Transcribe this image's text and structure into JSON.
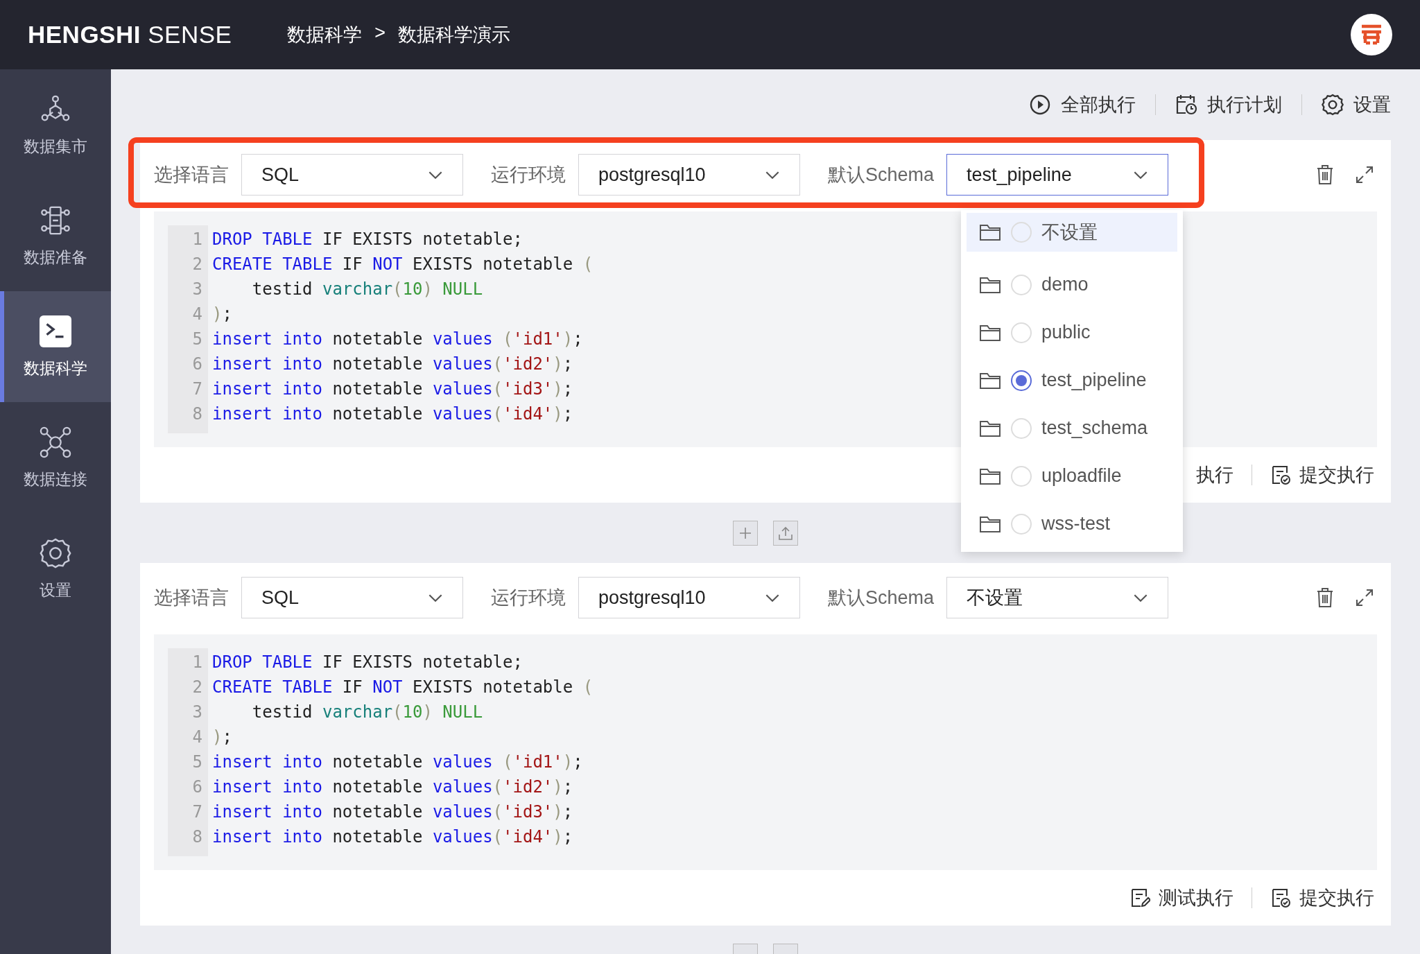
{
  "header": {
    "logo": "**HENGSHI** SENSE",
    "breadcrumb": [
      "数据科学",
      "数据科学演示"
    ],
    "separator": ">"
  },
  "sidebar": {
    "items": [
      {
        "label": "数据集市",
        "selected": false
      },
      {
        "label": "数据准备",
        "selected": false
      },
      {
        "label": "数据科学",
        "selected": true
      },
      {
        "label": "数据连接",
        "selected": false
      },
      {
        "label": "设置",
        "selected": false
      }
    ]
  },
  "toolbar": [
    "全部执行",
    "执行计划",
    "设置"
  ],
  "cells": [
    {
      "highlighted": true,
      "language_label": "选择语言",
      "language": "SQL",
      "env_label": "运行环境",
      "env": "postgresql10",
      "schema_label": "默认Schema",
      "schema": "test_pipeline",
      "schema_open": true,
      "code": [
        [
          {
            "kind": "keyword",
            "text": "DROP TABLE"
          },
          {
            "kind": "plain",
            "text": " IF EXISTS notetable;"
          }
        ],
        [
          {
            "kind": "keyword",
            "text": "CREATE TABLE"
          },
          {
            "kind": "plain",
            "text": " IF "
          },
          {
            "kind": "keyword",
            "text": "NOT"
          },
          {
            "kind": "plain",
            "text": " EXISTS notetable "
          },
          {
            "kind": "paren",
            "text": "("
          }
        ],
        [
          {
            "kind": "plain",
            "text": "    testid "
          },
          {
            "kind": "type",
            "text": "varchar"
          },
          {
            "kind": "paren",
            "text": "("
          },
          {
            "kind": "number",
            "text": "10"
          },
          {
            "kind": "paren",
            "text": ")"
          },
          {
            "kind": "null",
            "text": " NULL"
          }
        ],
        [
          {
            "kind": "paren",
            "text": ")"
          },
          {
            "kind": "plain",
            "text": ";"
          }
        ],
        [
          {
            "kind": "keyword",
            "text": "insert into"
          },
          {
            "kind": "plain",
            "text": " notetable "
          },
          {
            "kind": "keyword",
            "text": "values "
          },
          {
            "kind": "paren",
            "text": "("
          },
          {
            "kind": "string",
            "text": "'id1'"
          },
          {
            "kind": "paren",
            "text": ")"
          },
          {
            "kind": "plain",
            "text": ";"
          }
        ],
        [
          {
            "kind": "keyword",
            "text": "insert into"
          },
          {
            "kind": "plain",
            "text": " notetable "
          },
          {
            "kind": "keyword",
            "text": "values"
          },
          {
            "kind": "paren",
            "text": "("
          },
          {
            "kind": "string",
            "text": "'id2'"
          },
          {
            "kind": "paren",
            "text": ")"
          },
          {
            "kind": "plain",
            "text": ";"
          }
        ],
        [
          {
            "kind": "keyword",
            "text": "insert into"
          },
          {
            "kind": "plain",
            "text": " notetable "
          },
          {
            "kind": "keyword",
            "text": "values"
          },
          {
            "kind": "paren",
            "text": "("
          },
          {
            "kind": "string",
            "text": "'id3'"
          },
          {
            "kind": "paren",
            "text": ")"
          },
          {
            "kind": "plain",
            "text": ";"
          }
        ],
        [
          {
            "kind": "keyword",
            "text": "insert into"
          },
          {
            "kind": "plain",
            "text": " notetable "
          },
          {
            "kind": "keyword",
            "text": "values"
          },
          {
            "kind": "paren",
            "text": "("
          },
          {
            "kind": "string",
            "text": "'id4'"
          },
          {
            "kind": "paren",
            "text": ")"
          },
          {
            "kind": "plain",
            "text": ";"
          }
        ]
      ],
      "line_numbers": [
        "1",
        "2",
        "3",
        "4",
        "5",
        "6",
        "7",
        "8"
      ],
      "footer": [
        {
          "kind": "cut",
          "label": "执行"
        },
        {
          "kind": "submit",
          "label": "提交执行"
        }
      ]
    },
    {
      "highlighted": false,
      "language_label": "选择语言",
      "language": "SQL",
      "env_label": "运行环境",
      "env": "postgresql10",
      "schema_label": "默认Schema",
      "schema": "不设置",
      "schema_open": false,
      "code": [
        [
          {
            "kind": "keyword",
            "text": "DROP TABLE"
          },
          {
            "kind": "plain",
            "text": " IF EXISTS notetable;"
          }
        ],
        [
          {
            "kind": "keyword",
            "text": "CREATE TABLE"
          },
          {
            "kind": "plain",
            "text": " IF "
          },
          {
            "kind": "keyword",
            "text": "NOT"
          },
          {
            "kind": "plain",
            "text": " EXISTS notetable "
          },
          {
            "kind": "paren",
            "text": "("
          }
        ],
        [
          {
            "kind": "plain",
            "text": "    testid "
          },
          {
            "kind": "type",
            "text": "varchar"
          },
          {
            "kind": "paren",
            "text": "("
          },
          {
            "kind": "number",
            "text": "10"
          },
          {
            "kind": "paren",
            "text": ")"
          },
          {
            "kind": "null",
            "text": " NULL"
          }
        ],
        [
          {
            "kind": "paren",
            "text": ")"
          },
          {
            "kind": "plain",
            "text": ";"
          }
        ],
        [
          {
            "kind": "keyword",
            "text": "insert into"
          },
          {
            "kind": "plain",
            "text": " notetable "
          },
          {
            "kind": "keyword",
            "text": "values "
          },
          {
            "kind": "paren",
            "text": "("
          },
          {
            "kind": "string",
            "text": "'id1'"
          },
          {
            "kind": "paren",
            "text": ")"
          },
          {
            "kind": "plain",
            "text": ";"
          }
        ],
        [
          {
            "kind": "keyword",
            "text": "insert into"
          },
          {
            "kind": "plain",
            "text": " notetable "
          },
          {
            "kind": "keyword",
            "text": "values"
          },
          {
            "kind": "paren",
            "text": "("
          },
          {
            "kind": "string",
            "text": "'id2'"
          },
          {
            "kind": "paren",
            "text": ")"
          },
          {
            "kind": "plain",
            "text": ";"
          }
        ],
        [
          {
            "kind": "keyword",
            "text": "insert into"
          },
          {
            "kind": "plain",
            "text": " notetable "
          },
          {
            "kind": "keyword",
            "text": "values"
          },
          {
            "kind": "paren",
            "text": "("
          },
          {
            "kind": "string",
            "text": "'id3'"
          },
          {
            "kind": "paren",
            "text": ")"
          },
          {
            "kind": "plain",
            "text": ";"
          }
        ],
        [
          {
            "kind": "keyword",
            "text": "insert into"
          },
          {
            "kind": "plain",
            "text": " notetable "
          },
          {
            "kind": "keyword",
            "text": "values"
          },
          {
            "kind": "paren",
            "text": "("
          },
          {
            "kind": "string",
            "text": "'id4'"
          },
          {
            "kind": "paren",
            "text": ")"
          },
          {
            "kind": "plain",
            "text": ";"
          }
        ]
      ],
      "line_numbers": [
        "1",
        "2",
        "3",
        "4",
        "5",
        "6",
        "7",
        "8"
      ],
      "footer": [
        {
          "kind": "test",
          "label": "测试执行"
        },
        {
          "kind": "submit",
          "label": "提交执行"
        }
      ]
    }
  ],
  "schema_dropdown": {
    "options": [
      {
        "label": "不设置",
        "selected": false,
        "hovered": true
      },
      {
        "label": "demo",
        "selected": false,
        "hovered": false
      },
      {
        "label": "public",
        "selected": false,
        "hovered": false
      },
      {
        "label": "test_pipeline",
        "selected": true,
        "hovered": false
      },
      {
        "label": "test_schema",
        "selected": false,
        "hovered": false
      },
      {
        "label": "uploadfile",
        "selected": false,
        "hovered": false
      },
      {
        "label": "wss-test",
        "selected": false,
        "hovered": false
      }
    ]
  }
}
